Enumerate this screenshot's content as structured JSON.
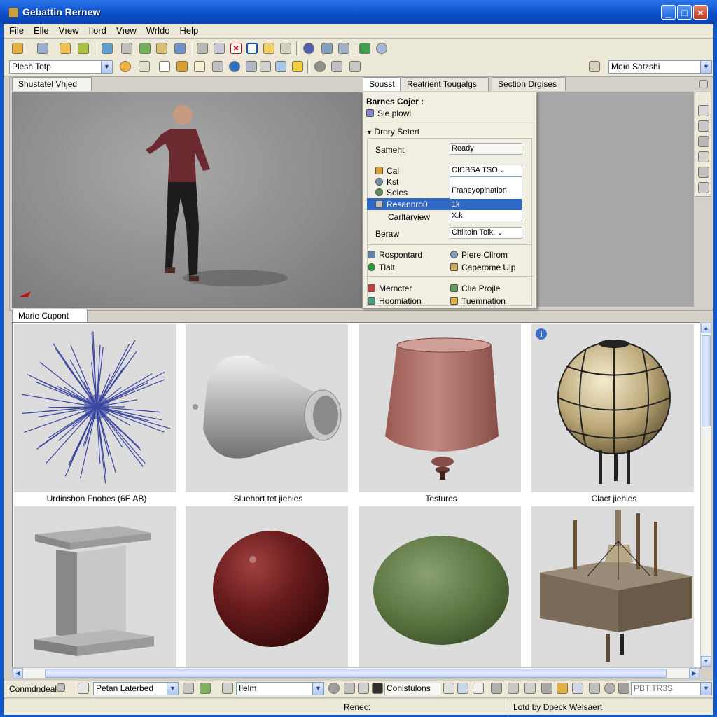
{
  "window": {
    "title": "Gebattin Rernew"
  },
  "menu": [
    "File",
    "Elle",
    "Vıew",
    "Ilord",
    "Vıew",
    "Wrldo",
    "Help"
  ],
  "toolbar2": {
    "combo_left": "Plesh Totp",
    "combo_right": "Moıd Satzshi"
  },
  "left_panel_tab": "Shustatel Vhjed",
  "right_tabs": [
    "Sousst",
    "Reatrient Tougalgs",
    "Section Drgises"
  ],
  "dropdown": {
    "header": "Barnes Cojer :",
    "sub": "Sle plowi",
    "section": "Drory Setert",
    "field_label": "Sameht",
    "field_value": "Ready",
    "items": [
      "Cal",
      "Kst",
      "Soles",
      "Resannro0",
      "Carltarview"
    ],
    "combo_value": "CICBSA TSO",
    "popup": [
      "Franeyopination",
      "1k",
      "X.k"
    ],
    "berau_label": "Beraw",
    "berau_value": "Chlltoin Tolk.",
    "actions": [
      "Rospontard",
      "Plere Cllrom",
      "Tlalt",
      "Caperome Ulp",
      "Merncter",
      "Clıa Prоjle",
      "Hoomiation",
      "Tuemnation"
    ]
  },
  "bottom_tab": "Marie Cupont",
  "gallery": {
    "captions": [
      "Urdinshon Fnobes (6E AB)",
      "Sluehort tet jiehies",
      "Testures",
      "Clact jiehies"
    ]
  },
  "bottom_bar": {
    "label": "Conmdndeal",
    "combo1": "Petan Laterbed",
    "combo2": "Ilelm",
    "field": "Conlstulons",
    "field_right": "PBT:TR3S"
  },
  "status": {
    "left": "Renec:",
    "right": "Lotd by Dpeck Welsaert"
  },
  "colors": {
    "title": "#0a4fc9",
    "accent": "#316ac5"
  }
}
